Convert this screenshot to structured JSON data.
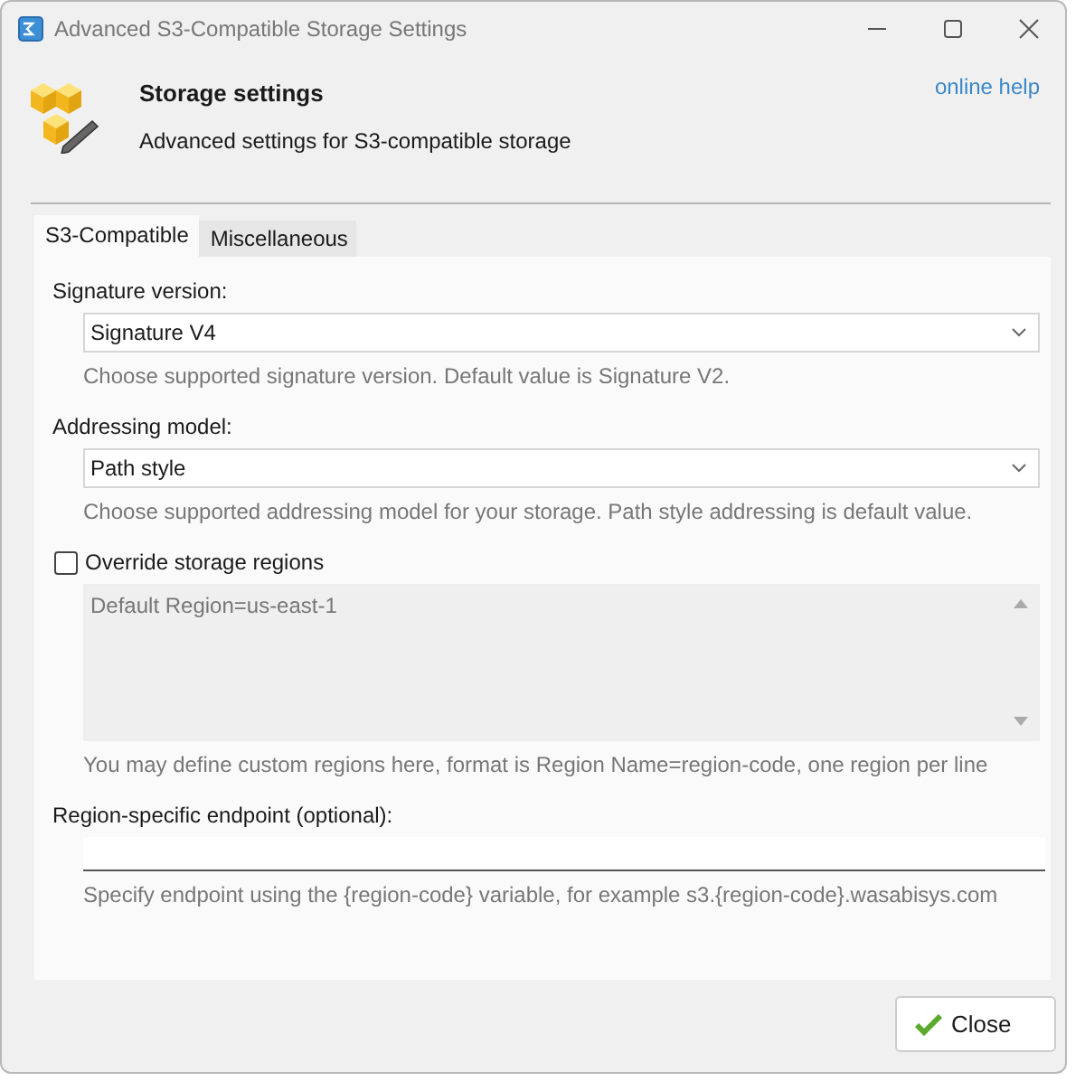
{
  "window": {
    "title": "Advanced S3-Compatible Storage Settings"
  },
  "header": {
    "title": "Storage settings",
    "subtitle": "Advanced settings for S3-compatible storage",
    "help_link": "online help"
  },
  "tabs": [
    {
      "label": "S3-Compatible",
      "selected": true
    },
    {
      "label": "Miscellaneous",
      "selected": false
    }
  ],
  "fields": [
    {
      "kind": "dropdown",
      "label": "Signature version:",
      "value": "Signature V4",
      "hint": "Choose supported signature version. Default value is Signature V2."
    },
    {
      "kind": "dropdown",
      "label": "Addressing model:",
      "value": "Path style",
      "hint": "Choose supported addressing model for your storage. Path style addressing is default value."
    },
    {
      "kind": "checkbox-textarea",
      "label": "Override storage regions",
      "checked": false,
      "disabled": true,
      "value": "Default Region=us-east-1",
      "hint": "You may define custom regions here, format is Region Name=region-code, one region per line"
    },
    {
      "kind": "text",
      "label": "Region-specific endpoint (optional):",
      "hint": "Specify endpoint using the {region-code} variable, for example s3.{region-code}.wasabisys.com"
    }
  ],
  "buttons": [
    {
      "label": "Close"
    }
  ]
}
